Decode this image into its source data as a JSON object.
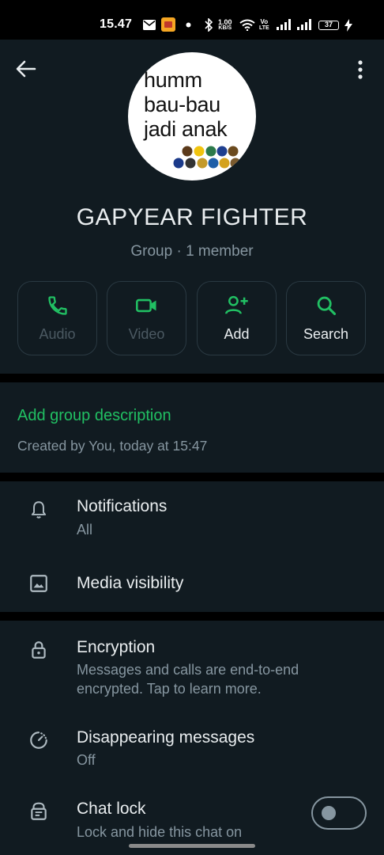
{
  "status_bar": {
    "time": "15.47",
    "net_speed_value": "1.00",
    "net_speed_unit": "KB/S",
    "volte_top": "Vo",
    "volte_bottom": "LTE",
    "battery": "37"
  },
  "header": {
    "back_icon": "arrow-left-icon",
    "menu_icon": "more-vertical-icon"
  },
  "group": {
    "avatar_lines": [
      "humm",
      "bau-bau",
      "jadi anak"
    ],
    "name": "GAPYEAR FIGHTER",
    "meta": "Group · 1 member"
  },
  "actions": [
    {
      "label": "Audio",
      "icon": "phone-icon",
      "enabled": false
    },
    {
      "label": "Video",
      "icon": "video-camera-icon",
      "enabled": false
    },
    {
      "label": "Add",
      "icon": "add-person-icon",
      "enabled": true
    },
    {
      "label": "Search",
      "icon": "search-icon",
      "enabled": true
    }
  ],
  "description": {
    "add_label": "Add group description",
    "created": "Created by You, today at 15:47"
  },
  "settings": {
    "notifications": {
      "title": "Notifications",
      "sub": "All",
      "icon": "bell-icon"
    },
    "media": {
      "title": "Media visibility",
      "icon": "image-icon"
    },
    "encryption": {
      "title": "Encryption",
      "sub": "Messages and calls are end-to-end encrypted. Tap to learn more.",
      "icon": "lock-icon"
    },
    "disappearing": {
      "title": "Disappearing messages",
      "sub": "Off",
      "icon": "timer-icon"
    },
    "chat_lock": {
      "title": "Chat lock",
      "sub": "Lock and hide this chat on",
      "icon": "chat-lock-icon",
      "toggle_on": false
    }
  },
  "colors": {
    "accent": "#21c063",
    "panel": "#111b21",
    "background": "#000000",
    "secondary_text": "#8696a0"
  }
}
